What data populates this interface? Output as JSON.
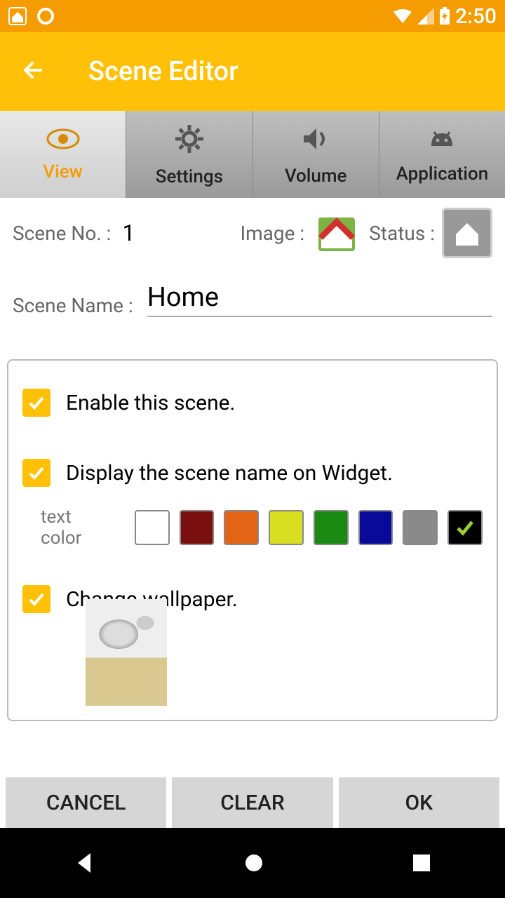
{
  "statusbar": {
    "time": "2:50"
  },
  "appbar": {
    "title": "Scene Editor"
  },
  "tabs": [
    {
      "label": "View",
      "icon": "eye-icon",
      "active": true
    },
    {
      "label": "Settings",
      "icon": "gear-icon",
      "active": false
    },
    {
      "label": "Volume",
      "icon": "speaker-icon",
      "active": false
    },
    {
      "label": "Application",
      "icon": "android-icon",
      "active": false
    }
  ],
  "info": {
    "scene_no_label": "Scene No. :",
    "scene_no_value": "1",
    "image_label": "Image :",
    "status_label": "Status :"
  },
  "name": {
    "label": "Scene Name :",
    "value": "Home"
  },
  "options": {
    "enable": "Enable this scene.",
    "display_widget": "Display the scene name on Widget.",
    "text_color_label": "text color",
    "change_wallpaper": "Change wallpaper."
  },
  "colors": [
    "#ffffff",
    "#7a0f0f",
    "#e36414",
    "#d8df20",
    "#1a8a12",
    "#0a0a9a",
    "#8a8a8a"
  ],
  "color_selected_index": 7,
  "footer": {
    "cancel": "CANCEL",
    "clear": "CLEAR",
    "ok": "OK"
  }
}
